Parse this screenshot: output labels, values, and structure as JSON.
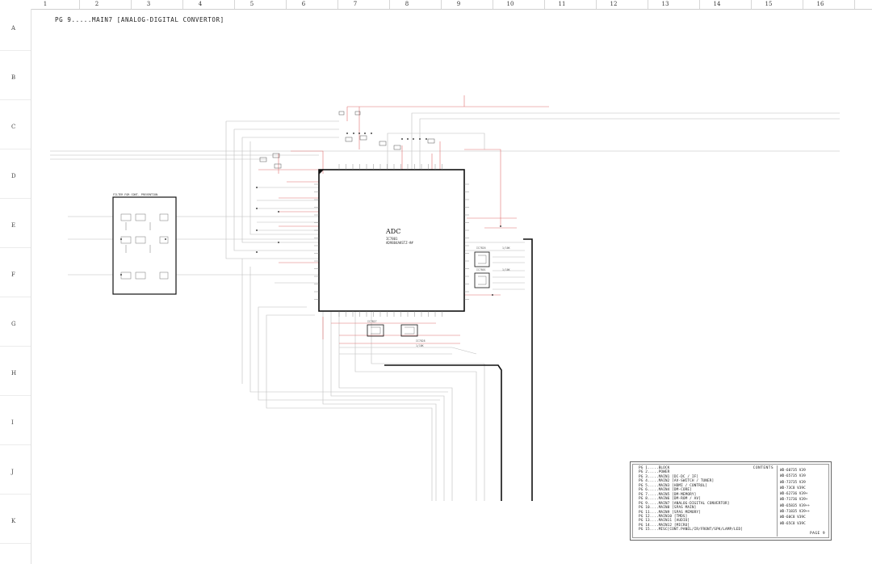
{
  "page_title": "PG 9.....MAIN7 [ANALOG-DIGITAL CONVERTOR]",
  "columns": [
    "1",
    "2",
    "3",
    "4",
    "5",
    "6",
    "7",
    "8",
    "9",
    "10",
    "11",
    "12",
    "13",
    "14",
    "15",
    "16"
  ],
  "rows": [
    "A",
    "B",
    "C",
    "D",
    "E",
    "F",
    "G",
    "H",
    "I",
    "J",
    "K"
  ],
  "adc": {
    "label": "ADC",
    "ref": "IC7801",
    "part": "AD9884AKSTZ-##"
  },
  "side_block_label": "FILTER FOR CONT. PREVENTION",
  "sub_chips": [
    {
      "ref": "IC7826",
      "note": "1/10K"
    },
    {
      "ref": "IC7801",
      "note": "1/10K"
    },
    {
      "ref": "IC7827",
      "note": "1/10K"
    },
    {
      "ref": "IC7828",
      "note": "1/10K"
    }
  ],
  "contents": {
    "header": "CONTENTS",
    "items": [
      "PG 1.....BLOCK",
      "PG 2.....POWER",
      "PG 3.....MAIN1 [DC-DC / IF]",
      "PG 4.....MAIN2 [AV-SWITCH / TUNER]",
      "PG 5.....MAIN3 [HDMI / CONTROL]",
      "PG 6.....MAIN4 [DM-CORE]",
      "PG 7.....MAIN5 [DM-MEMORY]",
      "PG 8.....MAIN6 [DM-ROM / AV]",
      "PG 9.....MAIN7 [ANALOG-DIGITAL CONVERTOR]",
      "PG 10....MAIN8 [SPAS MAIN]",
      "PG 11....MAIN9 [SPAS MEMORY]",
      "PG 12....MAIN10 [TMDS]",
      "PG 13....MAIN11 [AUDIO]",
      "PG 14....MAIN12 [MICRO]",
      "PG 15....MISC[CONT.PANEL/IR/FRONT/SPK/LAMP/LED]"
    ]
  },
  "models": [
    "WD-60735 V39",
    "WD-65735 V39",
    "WD-73735 V39",
    "WD-73C8 V39C",
    "WD-62736 V39+",
    "WD-71736 V39+",
    "WD-65835 V39++",
    "WD-71835 V39++",
    "WD-60C8 V39C",
    "WD-65C8 V39C"
  ],
  "page_label": "PAGE 9",
  "colors": {
    "wire": "#b8b8b8",
    "red_trace": "#e06464",
    "chip_border": "#111111",
    "bus": "#111111"
  }
}
